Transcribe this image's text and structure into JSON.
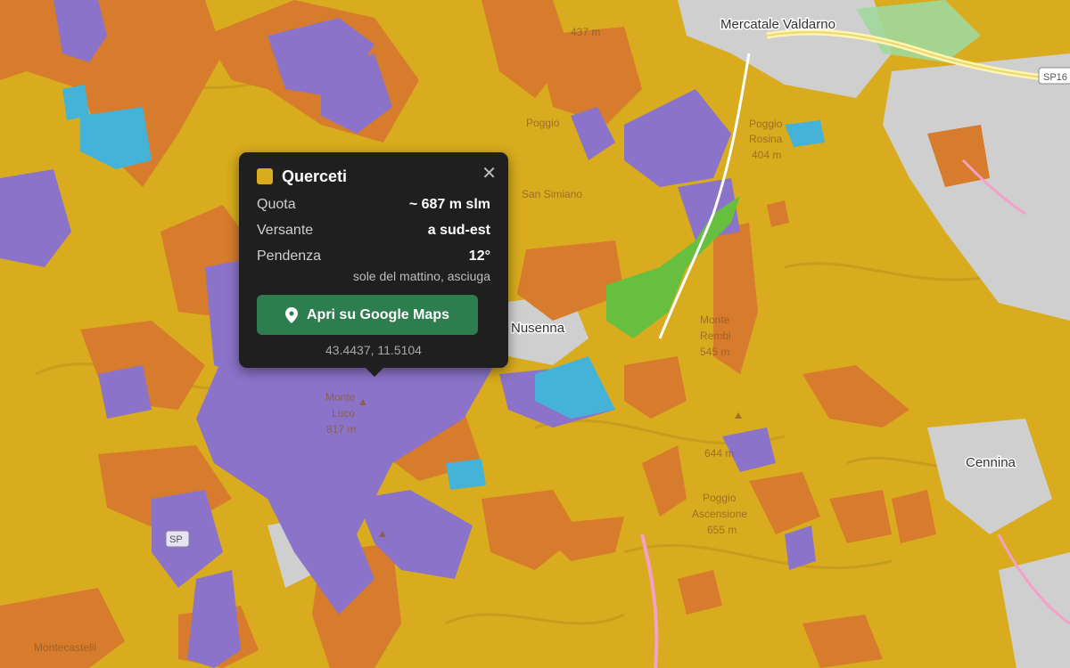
{
  "map": {
    "colors": {
      "querceti": "#d8ac1e",
      "castagneti": "#d77b2c",
      "lavender": "#8b73c9",
      "cyan": "#45b3d8",
      "green": "#67bf3f",
      "grey": "#c9c9c9"
    },
    "labels": {
      "mercatale": "Mercatale Valdarno",
      "nusenna": "Nusenna",
      "cennina": "Cennina",
      "sp1": "SP16",
      "sp2": "SP",
      "poggio_rosina": "Poggio",
      "poggio_rosina2": "Rosina",
      "poggio_rosina3": "404 m",
      "monte_rembu": "Monte",
      "monte_rembu2": "Rembi",
      "monte_rembu3": "545 m",
      "poggio_ascensione": "Poggio",
      "poggio_ascensione2": "Ascensione",
      "poggio_ascensione3": "655 m",
      "poggio_644": "644 m",
      "monte_luco": "Monte",
      "monte_luco2": "Luco",
      "monte_luco3": "817 m",
      "monte_castelli": "Montecastelli",
      "poggio_sansimo": "Poggio",
      "poggio_sansimo2": "San Simiano",
      "poggio_437": "437 m"
    }
  },
  "popup": {
    "title": "Querceti",
    "swatch_color": "#d8ac1e",
    "rows": [
      {
        "label": "Quota",
        "value": "~ 687 m slm"
      },
      {
        "label": "Versante",
        "value": "a sud-est"
      },
      {
        "label": "Pendenza",
        "value": "12°"
      }
    ],
    "note": "sole del mattino, asciuga",
    "button_label": "Apri su Google Maps",
    "button_icon": "map-pin-icon",
    "coords": "43.4437, 11.5104",
    "close_icon": "close-icon"
  }
}
